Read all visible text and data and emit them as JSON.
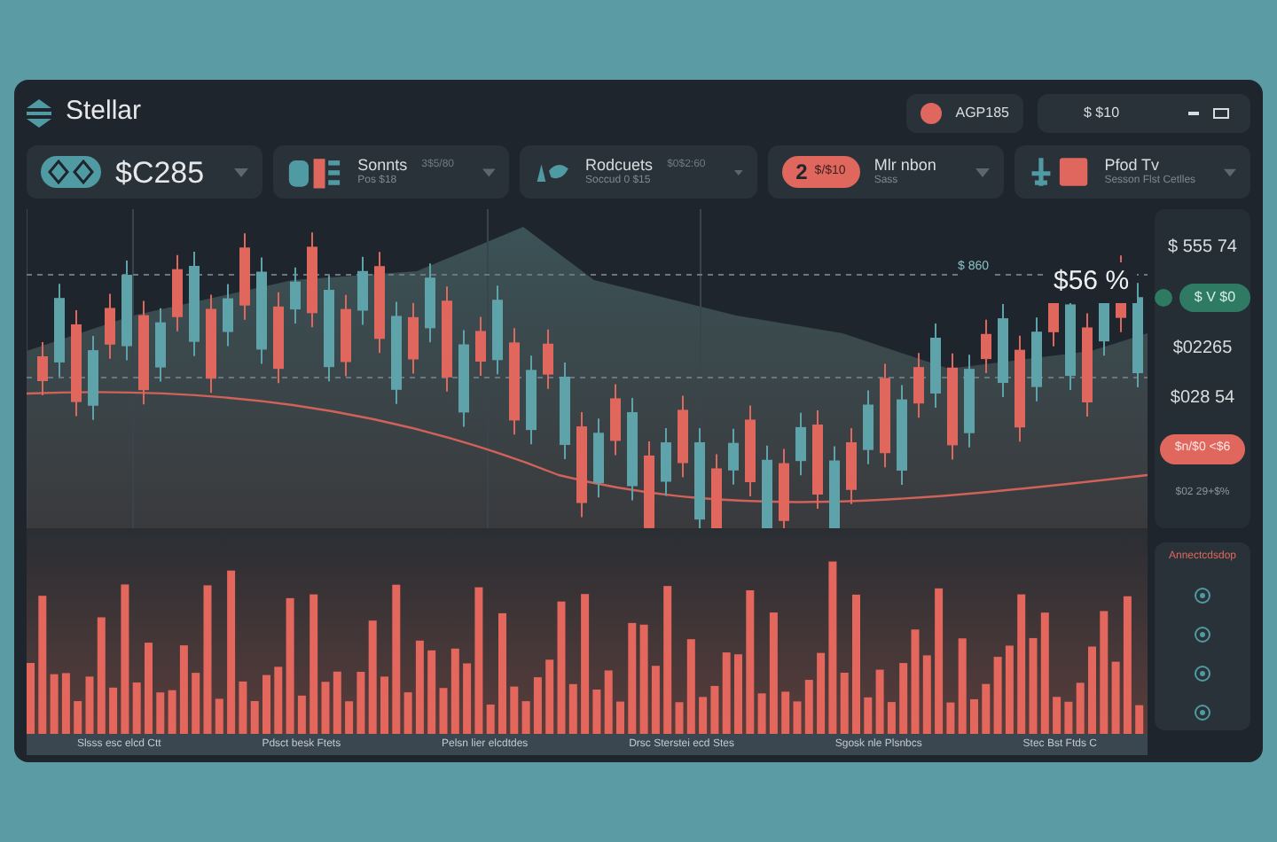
{
  "app": {
    "name": "Stellar"
  },
  "header": {
    "badge": "AGP185",
    "balance": "$ $10"
  },
  "cards": [
    {
      "kind": "price",
      "value": "$C285"
    },
    {
      "kind": "info",
      "title": "Sonnts",
      "meta": "3$5/80",
      "subtitle": "Pos $18"
    },
    {
      "kind": "info",
      "title": "Rodcuets",
      "meta": "$0$2:60",
      "subtitle": "Soccud 0 $15"
    },
    {
      "kind": "badge",
      "badge_number": "2",
      "badge_text": "$/$10",
      "title": "Mlr nbon",
      "subtitle": "Sass"
    },
    {
      "kind": "info",
      "title": "Pfod Tv",
      "subtitle": "Sesson Flst Cetlles"
    }
  ],
  "chart": {
    "price_label": "$56 %",
    "level_label": "$ 860"
  },
  "sidebar": [
    {
      "kind": "text",
      "text": "$ 555 74"
    },
    {
      "kind": "pill",
      "text": "$ V $0"
    },
    {
      "kind": "text",
      "text": "$02265"
    },
    {
      "kind": "text",
      "text": "$028 54"
    },
    {
      "kind": "alert",
      "text": "$n/$0 <$6"
    },
    {
      "kind": "small",
      "text": "$02 29+$%"
    }
  ],
  "panel": {
    "title": "Annectcdsdop"
  },
  "axis_labels": [
    "Slsss esc elcd Ctt",
    "Pdsct besk Ftets",
    "Pelsn lier elcdtdes",
    "Drsc Sterstei ecd Stes",
    "Sgosk nle Plsnbcs",
    "Stec Bst Ftds C"
  ]
}
